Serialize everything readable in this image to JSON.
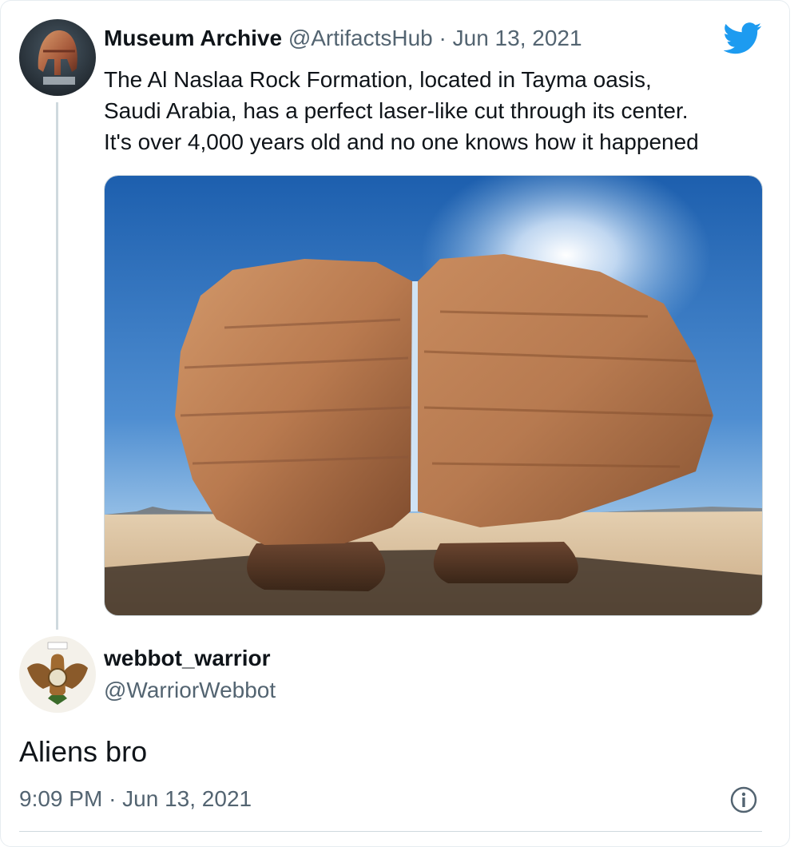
{
  "tweet": {
    "author_name": "Museum Archive",
    "author_handle": "@ArtifactsHub",
    "separator": "·",
    "date": "Jun 13, 2021",
    "text_lines": [
      "The Al Naslaa Rock Formation, located in Tayma oasis,",
      "Saudi Arabia, has a perfect laser-like cut through its center.",
      "It's over 4,000 years old and no one knows how it happened"
    ],
    "avatar_icon": "spartan-helmet-avatar",
    "brand_icon": "twitter-bird-icon",
    "brand_color": "#1d9bf0",
    "media_icon": "split-rock-photo"
  },
  "reply": {
    "author_name": "webbot_warrior",
    "author_handle": "@WarriorWebbot",
    "text": "Aliens bro",
    "time": "9:09 PM",
    "separator": "·",
    "date": "Jun 13, 2021",
    "avatar_icon": "eagle-emblem-avatar",
    "info_icon": "info-icon"
  }
}
